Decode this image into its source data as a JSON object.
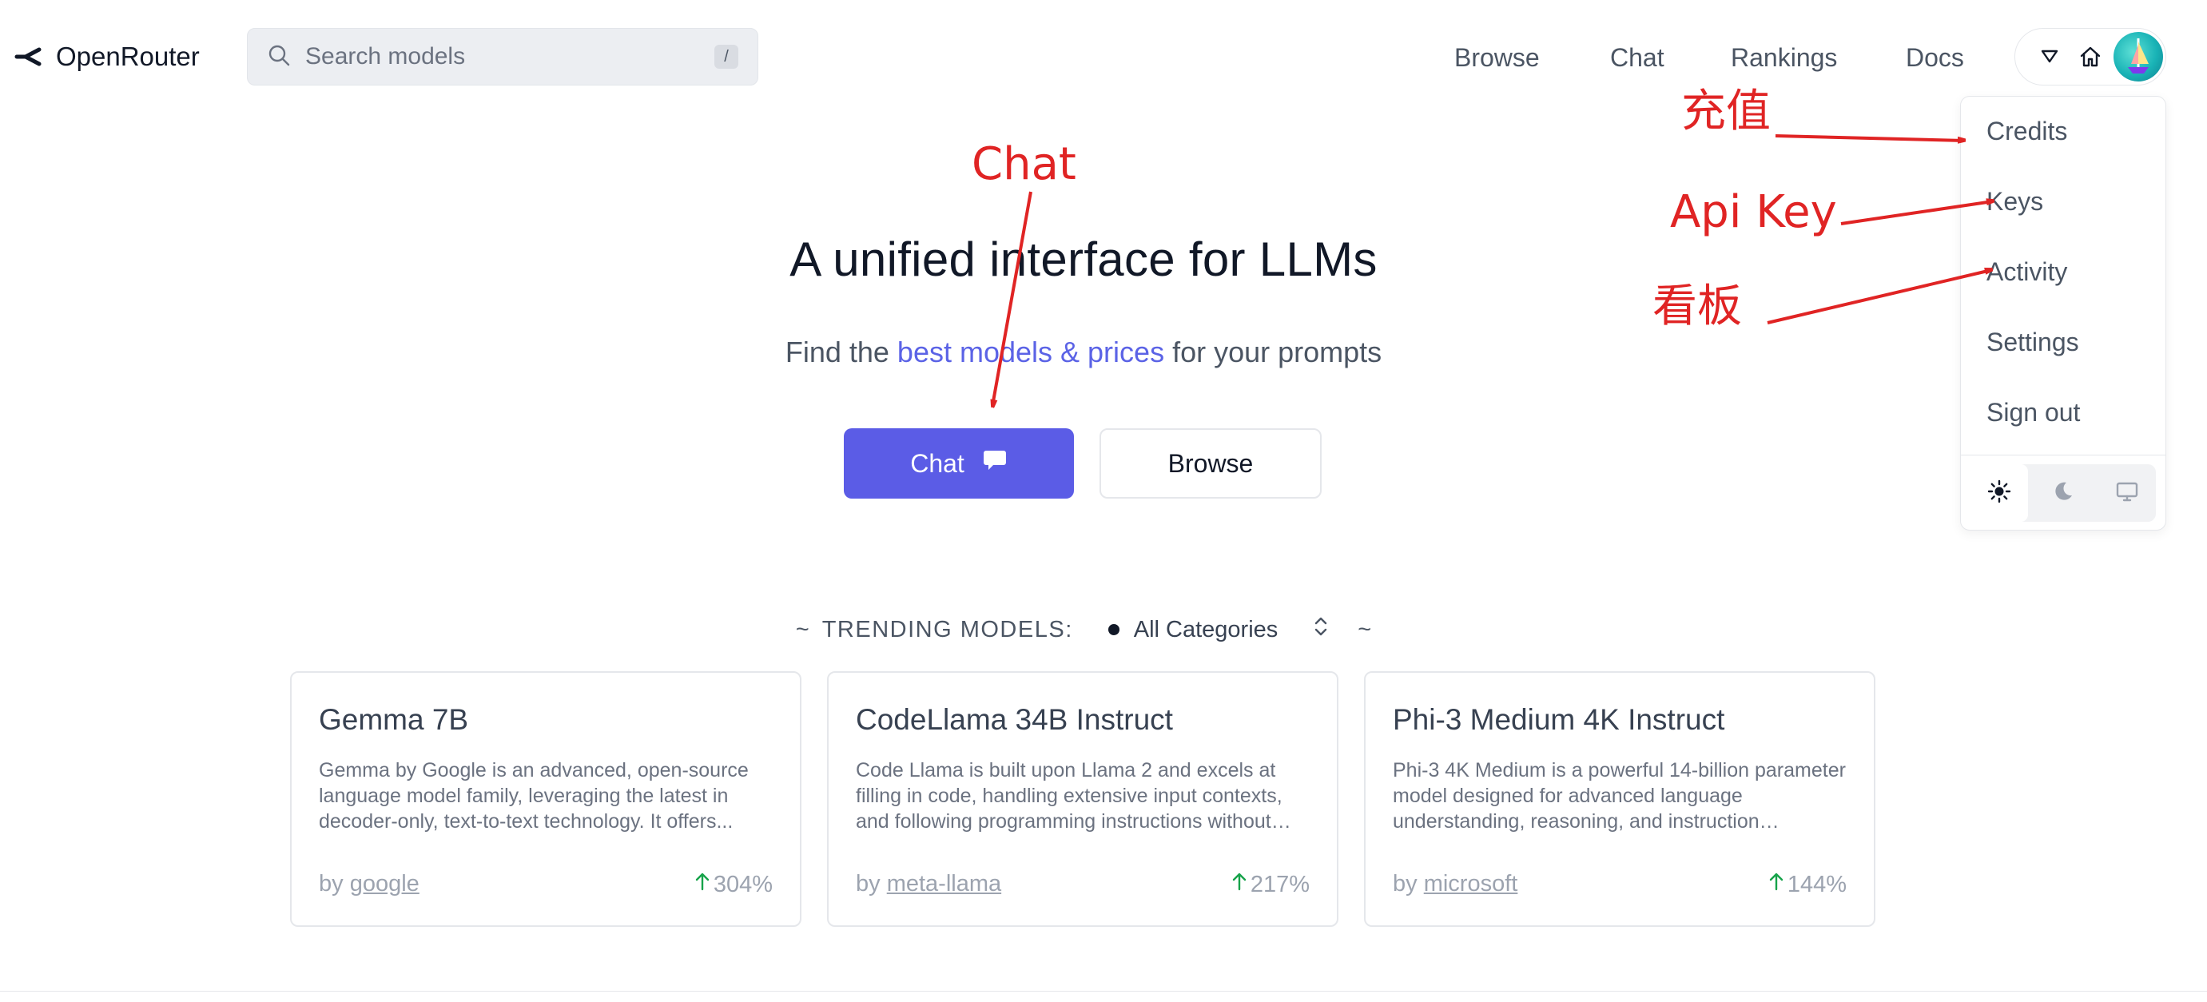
{
  "header": {
    "brand": "OpenRouter",
    "search": {
      "placeholder": "Search models",
      "shortcut": "/"
    },
    "nav": [
      "Browse",
      "Chat",
      "Rankings",
      "Docs"
    ]
  },
  "user_menu": {
    "items": [
      "Credits",
      "Keys",
      "Activity",
      "Settings",
      "Sign out"
    ],
    "theme_options": [
      "light",
      "dark",
      "system"
    ],
    "active_theme": "light"
  },
  "hero": {
    "title": "A unified interface for LLMs",
    "subtitle_prefix": "Find the ",
    "subtitle_link": "best models & prices",
    "subtitle_suffix": " for your prompts",
    "chat_button": "Chat",
    "browse_button": "Browse"
  },
  "trending": {
    "tilde": "~",
    "label": "TRENDING MODELS:",
    "category": "All Categories",
    "cards": [
      {
        "title": "Gemma 7B",
        "description": "Gemma by Google is an advanced, open-source language model family, leveraging the latest in decoder-only, text-to-text technology. It offers...",
        "by": "by",
        "author": "google",
        "change": "304%"
      },
      {
        "title": "CodeLlama 34B Instruct",
        "description": "Code Llama is built upon Llama 2 and excels at filling in code, handling extensive input contexts, and following programming instructions without prior...",
        "by": "by",
        "author": "meta-llama",
        "change": "217%"
      },
      {
        "title": "Phi-3 Medium 4K Instruct",
        "description": "Phi-3 4K Medium is a powerful 14-billion parameter model designed for advanced language understanding, reasoning, and instruction following...",
        "by": "by",
        "author": "microsoft",
        "change": "144%"
      }
    ]
  },
  "annotations": {
    "chat": "Chat",
    "credits": "充值",
    "keys": "Api Key",
    "activity": "看板"
  },
  "colors": {
    "accent": "#5b5ce6",
    "link": "#5b63e6",
    "annotation": "#e02424",
    "trend_up": "#16a34a"
  }
}
